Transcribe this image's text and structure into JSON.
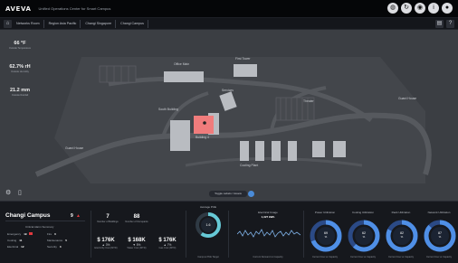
{
  "header": {
    "brand": "AVEVA",
    "app_title": "Unified Operations Center for Smart Campus"
  },
  "top_icons": [
    "globe-icon",
    "refresh-icon",
    "camera-icon",
    "info-icon",
    "user-icon"
  ],
  "breadcrumb": {
    "items": [
      "Networks Room",
      "Region Asia Pacific",
      "Changi Singapore",
      "Changi Campus"
    ]
  },
  "map": {
    "left_metrics": [
      {
        "value": "66 °F",
        "label": "Outside Temperature"
      },
      {
        "value": "62.7% rH",
        "label": "Outside Humidity"
      },
      {
        "value": "21.2 mm",
        "label": "Outside Rainfall"
      }
    ],
    "labels": {
      "office_main": "Office Main",
      "first_tower": "First Tower",
      "services": "Services",
      "south_building": "South Building",
      "theater": "Theater",
      "guard_house": "Guard House",
      "guard_north": "Guard House",
      "cooling_plant": "Cooling Plant",
      "highlight": "Building 4"
    },
    "toggle_label": "Toggle Labels / Assets",
    "accent": "#f07c7c"
  },
  "panel": {
    "campus_name": "Changi Campus",
    "alert_count": "9",
    "sub_title": "Critical Alarm Summary",
    "severity": [
      {
        "label": "Emergency",
        "value": "19"
      },
      {
        "label": "Fire",
        "value": "0"
      },
      {
        "label": "Cooling",
        "value": "11"
      },
      {
        "label": "Maintenance",
        "value": "5"
      },
      {
        "label": "Electrical",
        "value": "12"
      },
      {
        "label": "Security",
        "value": "3"
      }
    ],
    "counts": [
      {
        "value": "7",
        "label": "Number of Buildings"
      },
      {
        "value": "88",
        "label": "Number of Occupants"
      }
    ],
    "costs": [
      {
        "value": "$ 176K",
        "change": "▲ 3%",
        "label": "Electricity Cost (MTD)"
      },
      {
        "value": "$ 168K",
        "change": "▼ 5%",
        "label": "Water Cost (MTD)"
      },
      {
        "value": "$ 176K",
        "change": "▲ 7%",
        "label": "Gas Cost (MTD)"
      }
    ],
    "pue": {
      "title": "Average PUE",
      "value": "1.6",
      "foot": "Campus PUE Target",
      "fraction": 0.6
    },
    "usage": {
      "title": "Electrical Usage",
      "value": "1,327 kWh",
      "foot": "Current Demand vs Capacity"
    },
    "rings": [
      {
        "title": "Power Utilization",
        "value": "69",
        "unit": "%",
        "foot": "Current Use vs Capacity",
        "fraction": 0.69
      },
      {
        "title": "Cooling Utilization",
        "value": "62",
        "unit": "%",
        "foot": "Current Use vs Capacity",
        "fraction": 0.62
      },
      {
        "title": "Rack Utilization",
        "value": "82",
        "unit": "%",
        "foot": "Current Use vs Capacity",
        "fraction": 0.82
      },
      {
        "title": "Network Utilization",
        "value": "87",
        "unit": "%",
        "foot": "Current Use vs Capacity",
        "fraction": 0.87
      }
    ]
  },
  "colors": {
    "ring_track": "#2b4a86",
    "ring_fill": "#4f8fe6",
    "gauge_fill": "#66c9d6",
    "alert": "#e0393e"
  }
}
